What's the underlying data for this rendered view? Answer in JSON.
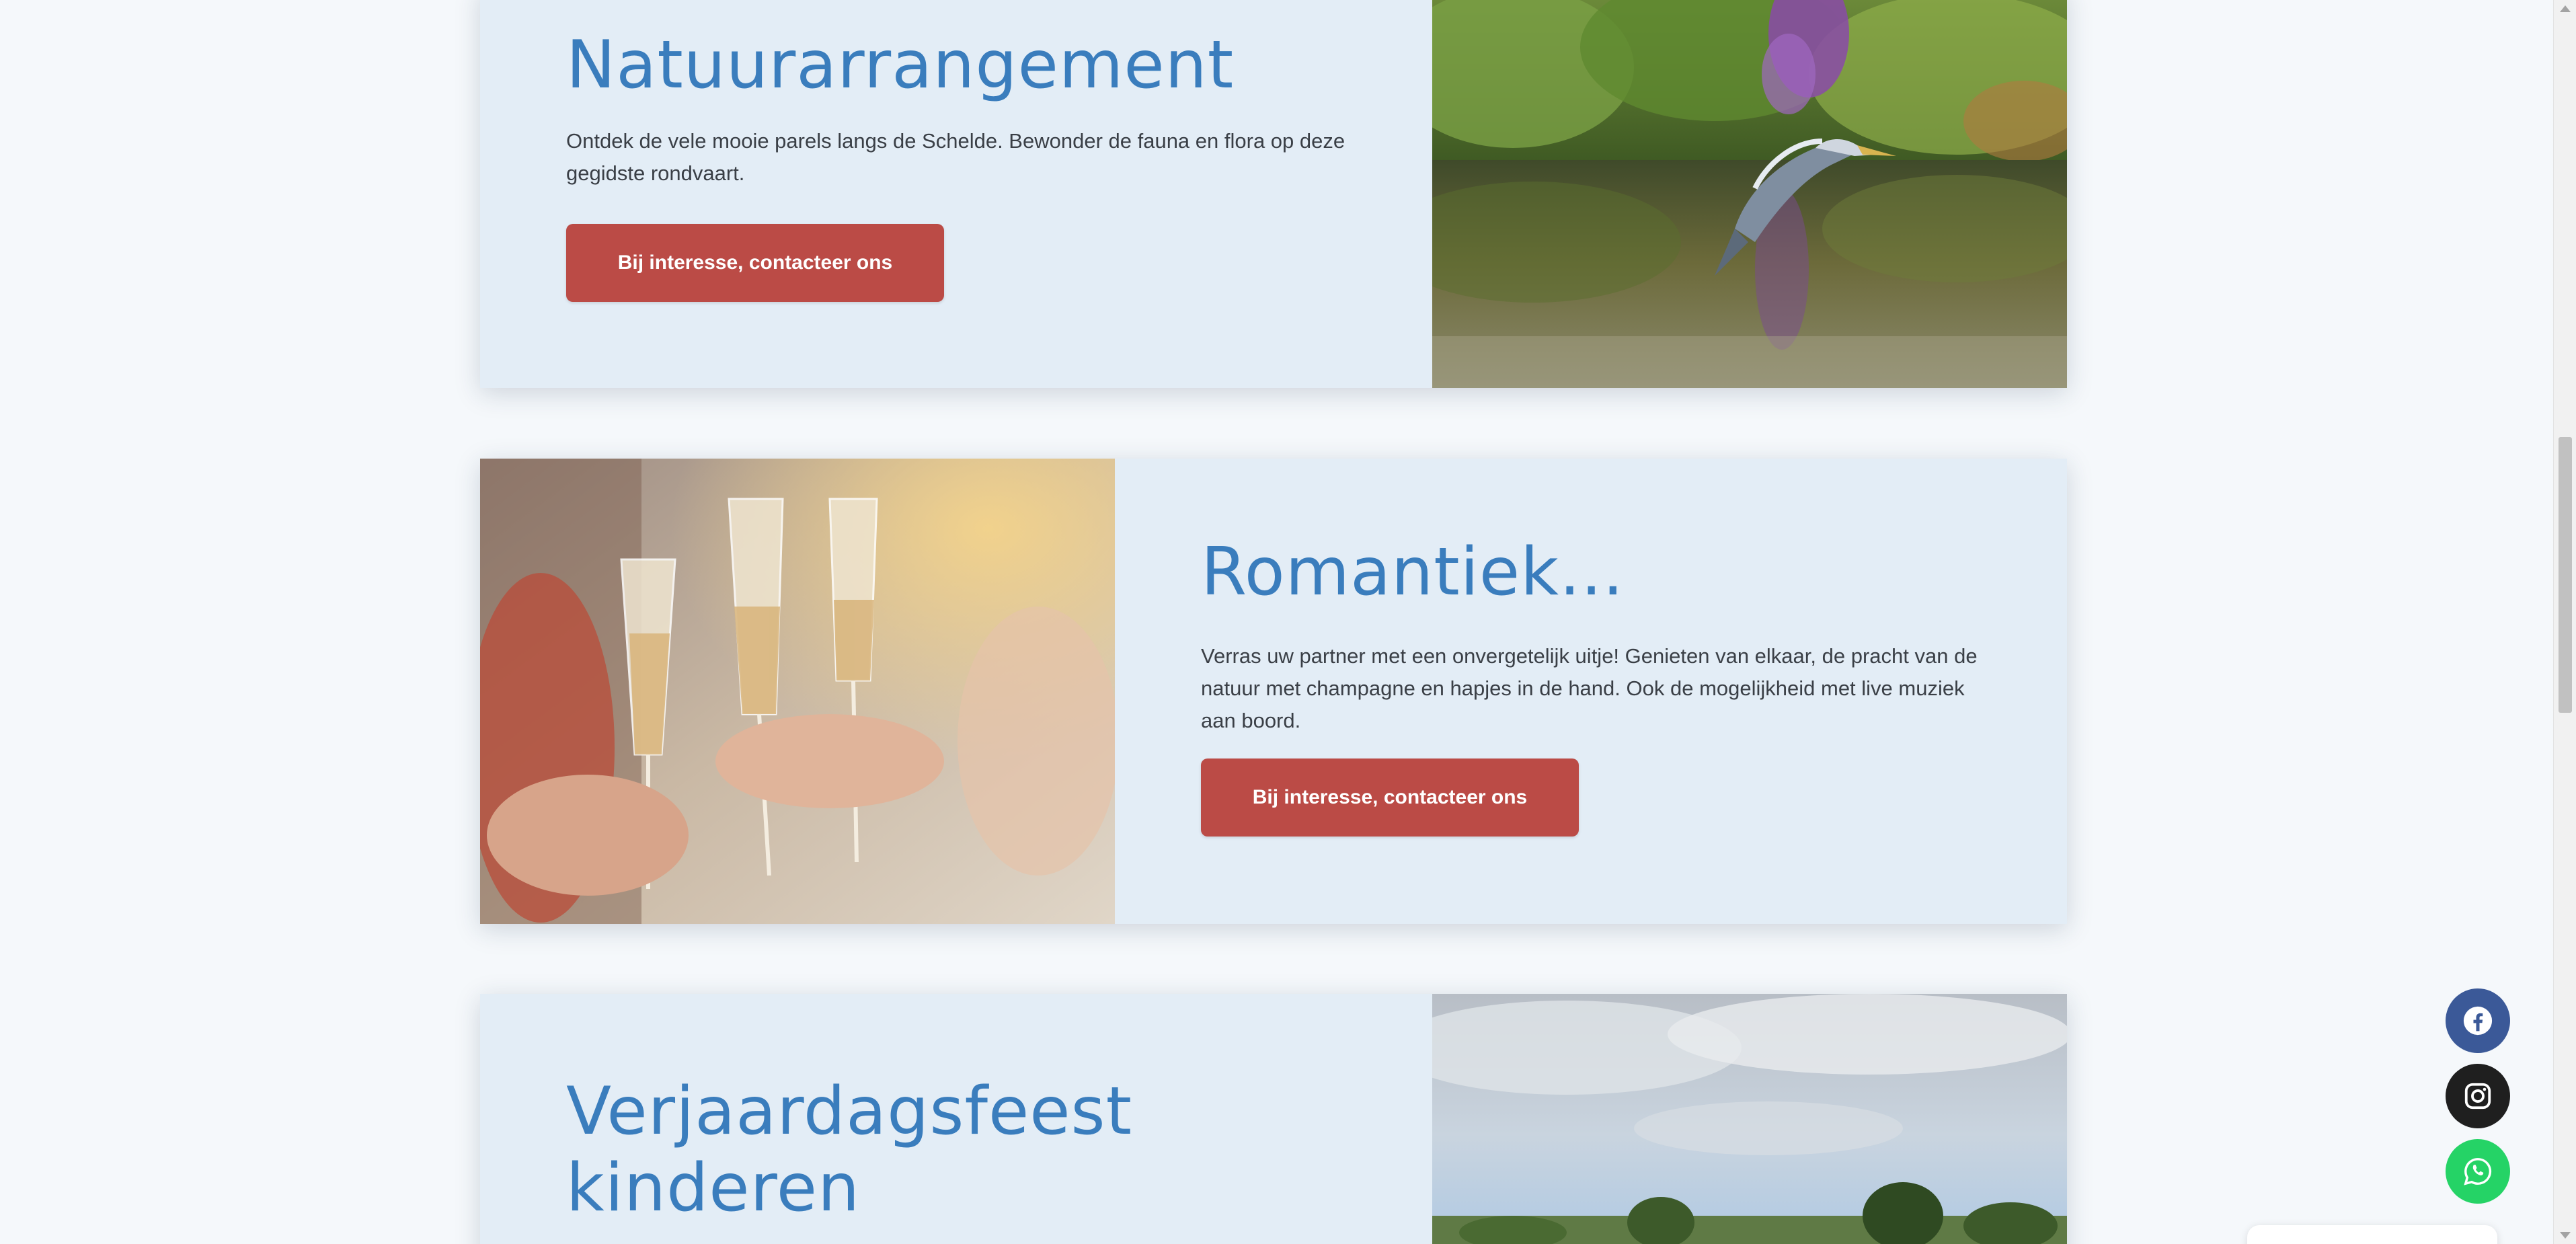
{
  "cards": [
    {
      "title": "Natuurarrangement",
      "description": "Ontdek de vele mooie parels langs de Schelde. Bewonder de fauna en flora op deze gegidste rondvaart.",
      "button_label": "Bij interesse, contacteer ons",
      "image_icon": "heron-over-water-photo"
    },
    {
      "title": "Romantiek...",
      "description": "Verras uw partner met een onvergetelijk uitje! Genieten van elkaar, de pracht van de natuur met champagne en hapjes in de hand. Ook de mogelijkheid met live muziek aan boord.",
      "button_label": "Bij interesse, contacteer ons",
      "image_icon": "champagne-toast-photo"
    },
    {
      "title_line1": "Verjaardagsfeest",
      "title_line2": "kinderen",
      "image_icon": "river-landscape-photo"
    }
  ],
  "social": {
    "facebook_icon": "facebook-icon",
    "instagram_icon": "instagram-icon",
    "whatsapp_icon": "whatsapp-icon"
  },
  "colors": {
    "title_blue": "#3a7dbd",
    "button_red": "#bb4b46",
    "card_bg": "#e3edf6",
    "page_bg": "#f5f8fb",
    "facebook": "#3b5998",
    "instagram": "#1f1f1f",
    "whatsapp": "#25d366"
  }
}
